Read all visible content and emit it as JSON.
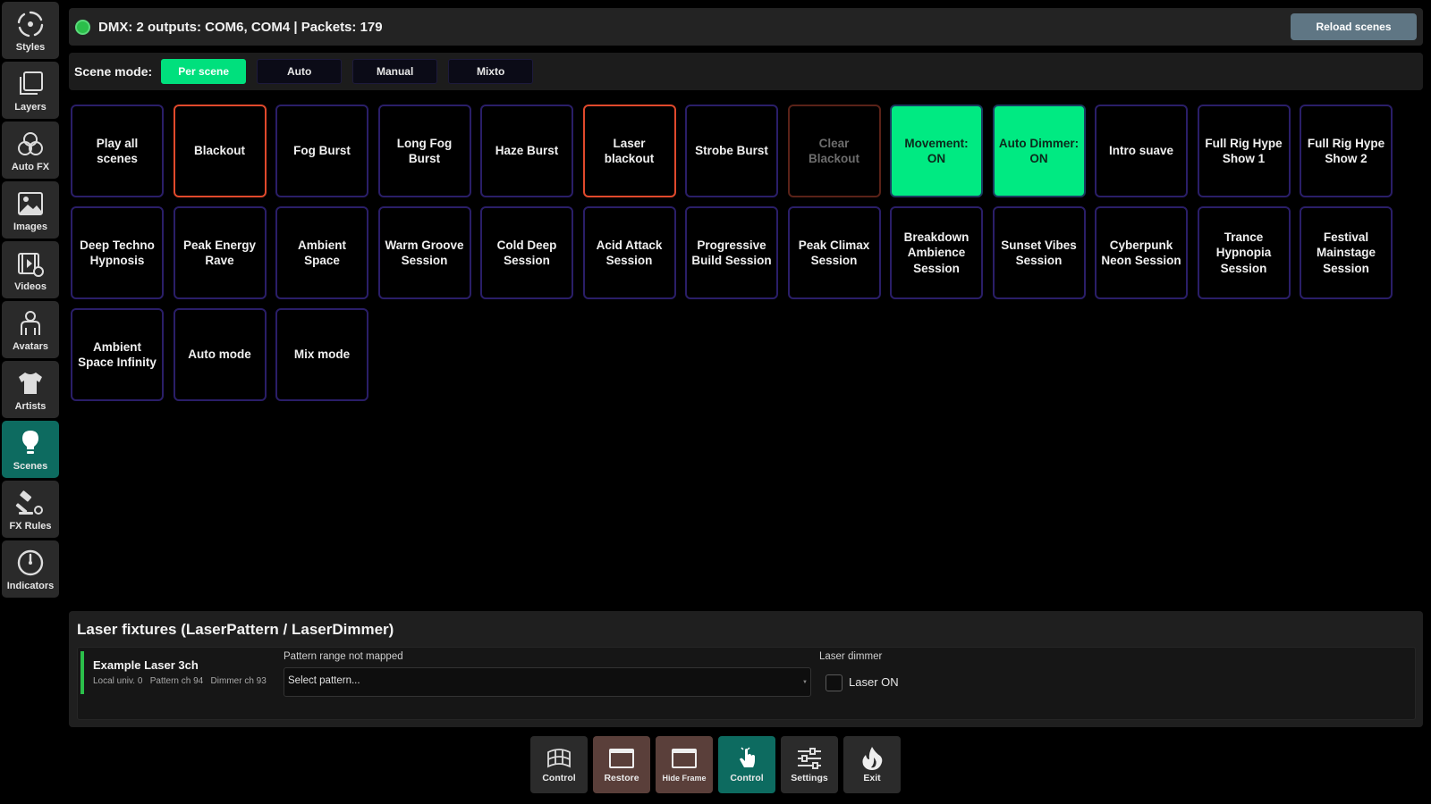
{
  "sidebar": {
    "items": [
      {
        "label": "Styles",
        "icon": "styles-icon"
      },
      {
        "label": "Layers",
        "icon": "layers-icon"
      },
      {
        "label": "Auto FX",
        "icon": "auto-fx-icon"
      },
      {
        "label": "Images",
        "icon": "image-icon"
      },
      {
        "label": "Videos",
        "icon": "video-icon"
      },
      {
        "label": "Avatars",
        "icon": "avatar-icon"
      },
      {
        "label": "Artists",
        "icon": "shirt-icon"
      },
      {
        "label": "Scenes",
        "icon": "lightbulb-icon",
        "active": true
      },
      {
        "label": "FX Rules",
        "icon": "gavel-icon"
      },
      {
        "label": "Indicators",
        "icon": "gauge-icon"
      }
    ]
  },
  "status": {
    "text": "DMX: 2 outputs: COM6, COM4 | Packets: 179",
    "indicator_color": "#2bbf4a",
    "reload_label": "Reload scenes"
  },
  "scene_mode": {
    "label": "Scene mode:",
    "options": [
      "Per scene",
      "Auto",
      "Manual",
      "Mixto"
    ],
    "selected": "Per scene"
  },
  "scenes": [
    {
      "label": "Play all scenes",
      "state": "normal"
    },
    {
      "label": "Blackout",
      "state": "red"
    },
    {
      "label": "Fog Burst",
      "state": "normal"
    },
    {
      "label": "Long Fog Burst",
      "state": "normal"
    },
    {
      "label": "Haze Burst",
      "state": "normal"
    },
    {
      "label": "Laser blackout",
      "state": "red"
    },
    {
      "label": "Strobe Burst",
      "state": "normal"
    },
    {
      "label": "Clear Blackout",
      "state": "dim-red"
    },
    {
      "label": "Movement: ON",
      "state": "on"
    },
    {
      "label": "Auto Dimmer: ON",
      "state": "on"
    },
    {
      "label": "Intro suave",
      "state": "normal"
    },
    {
      "label": "Full Rig Hype Show 1",
      "state": "normal"
    },
    {
      "label": "Full Rig Hype Show 2",
      "state": "normal"
    },
    {
      "label": "Deep Techno Hypnosis",
      "state": "normal"
    },
    {
      "label": "Peak Energy Rave",
      "state": "normal"
    },
    {
      "label": "Ambient Space",
      "state": "normal"
    },
    {
      "label": "Warm Groove Session",
      "state": "normal"
    },
    {
      "label": "Cold Deep Session",
      "state": "normal"
    },
    {
      "label": "Acid Attack Session",
      "state": "normal"
    },
    {
      "label": "Progressive Build Session",
      "state": "normal"
    },
    {
      "label": "Peak Climax Session",
      "state": "normal"
    },
    {
      "label": "Breakdown Ambience Session",
      "state": "normal"
    },
    {
      "label": "Sunset Vibes Session",
      "state": "normal"
    },
    {
      "label": "Cyberpunk Neon Session",
      "state": "normal"
    },
    {
      "label": "Trance Hypnopia Session",
      "state": "normal"
    },
    {
      "label": "Festival Mainstage Session",
      "state": "normal"
    },
    {
      "label": "Ambient Space Infinity",
      "state": "normal"
    },
    {
      "label": "Auto mode",
      "state": "normal"
    },
    {
      "label": "Mix mode",
      "state": "normal"
    }
  ],
  "laser_panel": {
    "title": "Laser fixtures (LaserPattern / LaserDimmer)",
    "fixture": {
      "name": "Example Laser 3ch",
      "meta": "Local univ. 0   Pattern ch 94   Dimmer ch 93",
      "pattern_label": "Pattern range not mapped",
      "pattern_placeholder": "Select pattern...",
      "dimmer_label": "Laser dimmer",
      "laser_on_label": "Laser ON",
      "laser_on_checked": false
    }
  },
  "toolbar": {
    "items": [
      {
        "label": "Control",
        "icon": "grid-globe-icon",
        "style": "normal"
      },
      {
        "label": "Restore",
        "icon": "window-restore-icon",
        "style": "brown"
      },
      {
        "label": "Hide Frame",
        "icon": "hide-frame-icon",
        "style": "brown"
      },
      {
        "label": "Control",
        "icon": "touch-hand-icon",
        "style": "teal"
      },
      {
        "label": "Settings",
        "icon": "sliders-icon",
        "style": "normal"
      },
      {
        "label": "Exit",
        "icon": "exit-flame-icon",
        "style": "normal"
      }
    ]
  }
}
